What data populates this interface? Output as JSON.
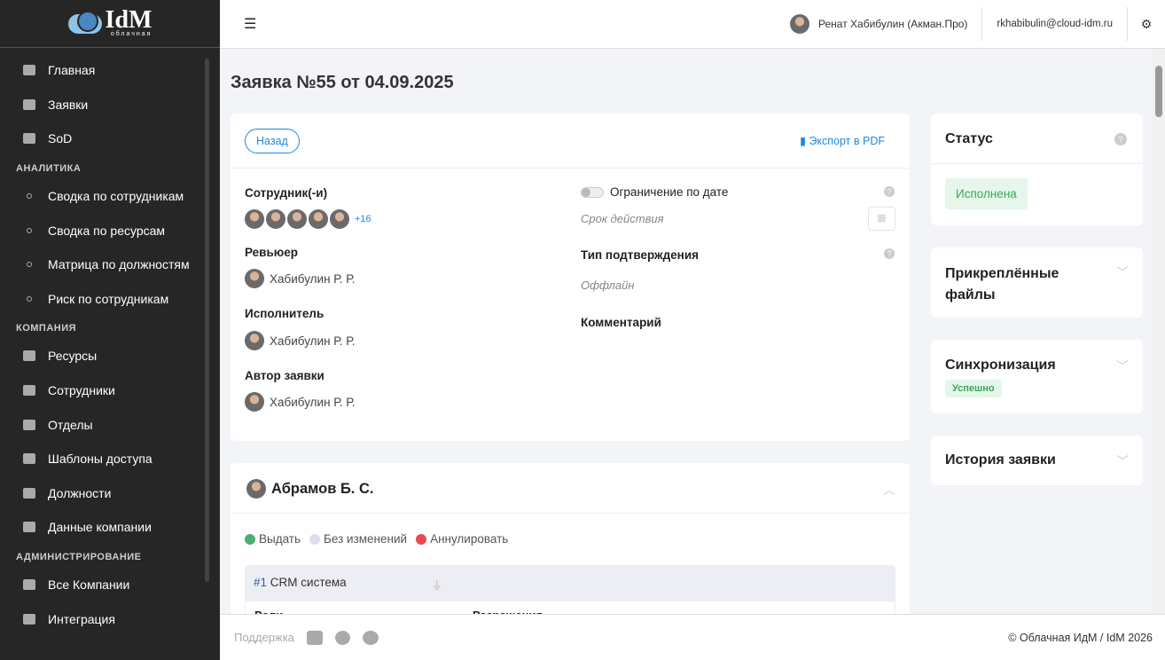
{
  "logo": {
    "text": "IdM",
    "subtitle": "облачная"
  },
  "sidebar": {
    "items": [
      {
        "label": "Главная",
        "icon": "home-icon"
      },
      {
        "label": "Заявки",
        "icon": "clipboard-icon"
      },
      {
        "label": "SoD",
        "icon": "sitemap-icon"
      },
      {
        "section": "АНАЛИТИКА"
      },
      {
        "label": "Сводка по сотрудникам",
        "icon": "circle-icon"
      },
      {
        "label": "Сводка по ресурсам",
        "icon": "circle-icon"
      },
      {
        "label": "Матрица по должностям",
        "icon": "circle-icon"
      },
      {
        "label": "Риск по сотрудникам",
        "icon": "circle-icon"
      },
      {
        "section": "КОМПАНИЯ"
      },
      {
        "label": "Ресурсы",
        "icon": "layers-icon"
      },
      {
        "label": "Сотрудники",
        "icon": "user-icon"
      },
      {
        "label": "Отделы",
        "icon": "users-icon"
      },
      {
        "label": "Шаблоны доступа",
        "icon": "calendar-check-icon"
      },
      {
        "label": "Должности",
        "icon": "id-card-icon"
      },
      {
        "label": "Данные компании",
        "icon": "building-icon"
      },
      {
        "section": "АДМИНИСТРИРОВАНИЕ"
      },
      {
        "label": "Все Компании",
        "icon": "user-icon"
      },
      {
        "label": "Интеграция",
        "icon": "plug-icon"
      }
    ]
  },
  "header": {
    "user_name": "Ренат Хабибулин (Акман.Про)",
    "email": "rkhabibulin@cloud-idm.ru"
  },
  "page": {
    "title": "Заявка №55 от 04.09.2025"
  },
  "request": {
    "back": "Назад",
    "export": "Экспорт в PDF",
    "employees_label": "Сотрудник(-и)",
    "employees_more": "+16",
    "reviewer_label": "Ревьюер",
    "reviewer": "Хабибулин Р. Р.",
    "executor_label": "Исполнитель",
    "executor": "Хабибулин Р. Р.",
    "author_label": "Автор заявки",
    "author": "Хабибулин Р. Р.",
    "date_limit_label": "Ограничение по дате",
    "date_limit_enabled": false,
    "validity_placeholder": "Срок действия",
    "confirm_type_label": "Тип подтверждения",
    "confirm_type": "Оффлайн",
    "comment_label": "Комментарий"
  },
  "employee_card": {
    "name": "Абрамов Б. С.",
    "legend": [
      "Выдать",
      "Без изменений",
      "Аннулировать"
    ],
    "resource_num": "#1",
    "resource": "CRM система",
    "col_roles": "Роли",
    "col_permissions": "Разрешения"
  },
  "status": {
    "title": "Статус",
    "value": "Исполнена"
  },
  "files": {
    "title": "Прикреплённые файлы"
  },
  "sync": {
    "title": "Синхронизация",
    "value": "Успешно"
  },
  "history": {
    "title": "История заявки"
  },
  "footer": {
    "support": "Поддержка",
    "copyright": "© Облачная ИдМ / IdM 2026"
  }
}
